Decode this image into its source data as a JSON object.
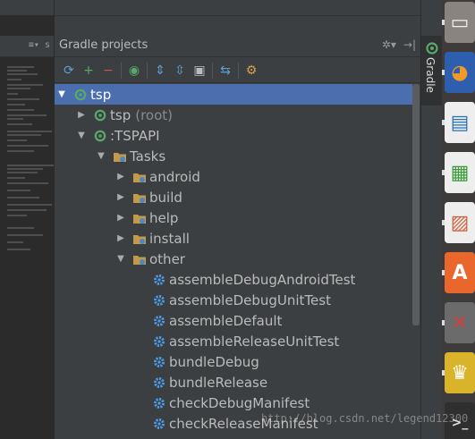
{
  "panel": {
    "title": "Gradle projects",
    "header_tools": {
      "settings_glyph": "✲▾",
      "hide_glyph": "→|"
    }
  },
  "editor": {
    "tabbar_glyph": "≡▾ s"
  },
  "toolbar": {
    "buttons": [
      {
        "name": "refresh-all-icon",
        "glyph": "⟳",
        "color": "#5f9fd6"
      },
      {
        "name": "add-icon",
        "glyph": "+",
        "color": "#59a869"
      },
      {
        "name": "remove-icon",
        "glyph": "−",
        "color": "#c75450"
      },
      {
        "name": "execute-task-icon",
        "glyph": "◉",
        "color": "#59a869"
      },
      {
        "name": "expand-all-icon",
        "glyph": "⇕",
        "color": "#5f9fd6"
      },
      {
        "name": "collapse-all-icon",
        "glyph": "⇳",
        "color": "#5f9fd6"
      },
      {
        "name": "toggle-offline-icon",
        "glyph": "▣",
        "color": "#bbbbbb"
      },
      {
        "name": "show-dependencies-icon",
        "glyph": "⇆",
        "color": "#5f9fd6"
      },
      {
        "name": "gradle-settings-icon",
        "glyph": "⚙",
        "color": "#d6a24a"
      }
    ]
  },
  "tree": [
    {
      "label": "tsp",
      "suffix": "",
      "level": 0,
      "arrow": "▼",
      "icon": "gradle-project-icon",
      "selected": true
    },
    {
      "label": "tsp",
      "suffix": "(root)",
      "level": 1,
      "arrow": "▶",
      "icon": "gradle-project-icon",
      "selected": false
    },
    {
      "label": ":TSPAPI",
      "suffix": "",
      "level": 1,
      "arrow": "▼",
      "icon": "gradle-project-icon",
      "selected": false
    },
    {
      "label": "Tasks",
      "suffix": "",
      "level": 2,
      "arrow": "▼",
      "icon": "task-folder-icon",
      "selected": false
    },
    {
      "label": "android",
      "suffix": "",
      "level": 3,
      "arrow": "▶",
      "icon": "task-folder-icon",
      "selected": false
    },
    {
      "label": "build",
      "suffix": "",
      "level": 3,
      "arrow": "▶",
      "icon": "task-folder-icon",
      "selected": false
    },
    {
      "label": "help",
      "suffix": "",
      "level": 3,
      "arrow": "▶",
      "icon": "task-folder-icon",
      "selected": false
    },
    {
      "label": "install",
      "suffix": "",
      "level": 3,
      "arrow": "▶",
      "icon": "task-folder-icon",
      "selected": false
    },
    {
      "label": "other",
      "suffix": "",
      "level": 3,
      "arrow": "▼",
      "icon": "task-folder-icon",
      "selected": false
    },
    {
      "label": "assembleDebugAndroidTest",
      "suffix": "",
      "level": 4,
      "arrow": "",
      "icon": "gear-icon",
      "selected": false
    },
    {
      "label": "assembleDebugUnitTest",
      "suffix": "",
      "level": 4,
      "arrow": "",
      "icon": "gear-icon",
      "selected": false
    },
    {
      "label": "assembleDefault",
      "suffix": "",
      "level": 4,
      "arrow": "",
      "icon": "gear-icon",
      "selected": false
    },
    {
      "label": "assembleReleaseUnitTest",
      "suffix": "",
      "level": 4,
      "arrow": "",
      "icon": "gear-icon",
      "selected": false
    },
    {
      "label": "bundleDebug",
      "suffix": "",
      "level": 4,
      "arrow": "",
      "icon": "gear-icon",
      "selected": false
    },
    {
      "label": "bundleRelease",
      "suffix": "",
      "level": 4,
      "arrow": "",
      "icon": "gear-icon",
      "selected": false
    },
    {
      "label": "checkDebugManifest",
      "suffix": "",
      "level": 4,
      "arrow": "",
      "icon": "gear-icon",
      "selected": false
    },
    {
      "label": "checkReleaseManifest",
      "suffix": "",
      "level": 4,
      "arrow": "",
      "icon": "gear-icon",
      "selected": false
    }
  ],
  "side_tab": {
    "label": "Gradle"
  },
  "dock": [
    {
      "name": "files-app-icon",
      "glyph": "▭",
      "bg": "#8a8480",
      "fg": "#f0f0f0"
    },
    {
      "name": "firefox-icon",
      "glyph": "◕",
      "bg": "#2d5fae",
      "fg": "#f39a26"
    },
    {
      "name": "libreoffice-writer-icon",
      "glyph": "▤",
      "bg": "#eeeeee",
      "fg": "#2a6fb8"
    },
    {
      "name": "libreoffice-calc-icon",
      "glyph": "▦",
      "bg": "#eeeeee",
      "fg": "#3a9a3a"
    },
    {
      "name": "libreoffice-impress-icon",
      "glyph": "▨",
      "bg": "#eeeeee",
      "fg": "#d0603a"
    },
    {
      "name": "software-center-icon",
      "glyph": "A",
      "bg": "#e9662c",
      "fg": "#ffffff"
    },
    {
      "name": "system-settings-icon",
      "glyph": "✕",
      "bg": "#6b6b6b",
      "fg": "#d04040"
    },
    {
      "name": "crown-app-icon",
      "glyph": "♛",
      "bg": "#d9b42a",
      "fg": "#ffffff"
    },
    {
      "name": "terminal-icon",
      "glyph": ">_",
      "bg": "#2f2f2f",
      "fg": "#e0e0e0"
    }
  ],
  "watermark": "http://blog.csdn.net/legend12300"
}
